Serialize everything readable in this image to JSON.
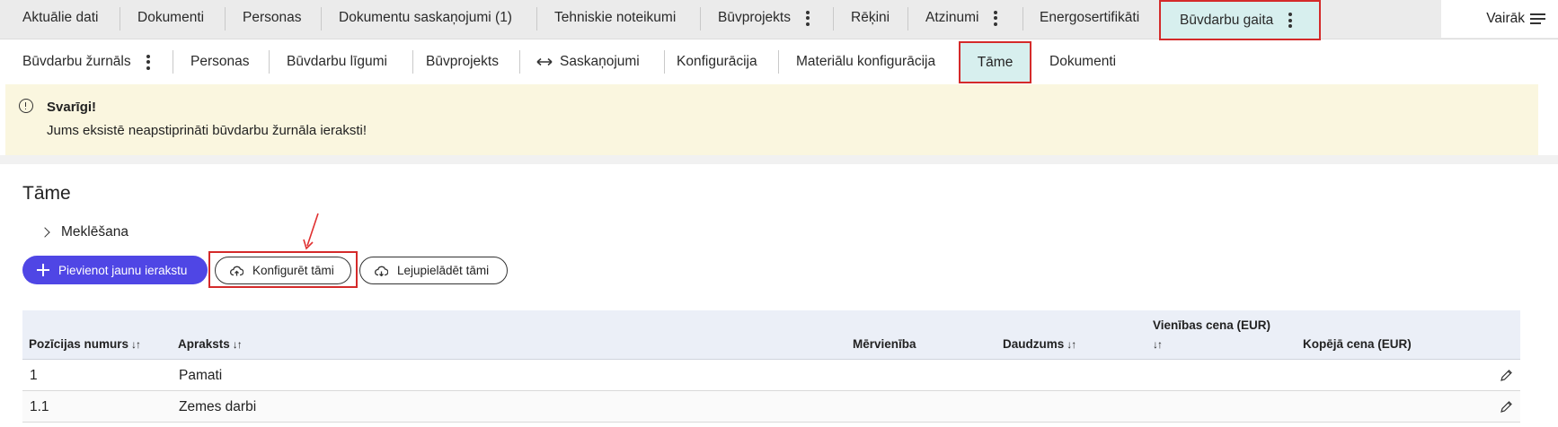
{
  "top_nav": {
    "tabs": [
      {
        "label": "Aktuālie dati"
      },
      {
        "label": "Dokumenti"
      },
      {
        "label": "Personas"
      },
      {
        "label": "Dokumentu saskaņojumi (1)"
      },
      {
        "label": "Tehniskie noteikumi"
      },
      {
        "label": "Būvprojekts"
      },
      {
        "label": "Rēķini"
      },
      {
        "label": "Atzinumi"
      },
      {
        "label": "Energosertifikāti"
      },
      {
        "label": "Būvdarbu gaita"
      }
    ],
    "active": "Būvdarbu gaita",
    "more_label": "Vairāk"
  },
  "sub_nav": {
    "tabs": [
      {
        "label": "Būvdarbu žurnāls"
      },
      {
        "label": "Personas"
      },
      {
        "label": "Būvdarbu līgumi"
      },
      {
        "label": "Būvprojekts"
      },
      {
        "label": "Saskaņojumi"
      },
      {
        "label": "Konfigurācija"
      },
      {
        "label": "Materiālu konfigurācija"
      },
      {
        "label": "Tāme"
      },
      {
        "label": "Dokumenti"
      }
    ],
    "active": "Tāme"
  },
  "alert": {
    "title": "Svarīgi!",
    "message": "Jums eksistē neapstiprināti būvdarbu žurnāla ieraksti!"
  },
  "main": {
    "title": "Tāme",
    "search_label": "Meklēšana",
    "buttons": {
      "add": "Pievienot jaunu ierakstu",
      "configure": "Konfigurēt tāmi",
      "download": "Lejupielādēt tāmi"
    }
  },
  "table": {
    "columns": [
      {
        "label": "Pozīcijas numurs",
        "sort": "↓↑"
      },
      {
        "label": "Apraksts",
        "sort": "↓↑"
      },
      {
        "label": "Mērvienība"
      },
      {
        "label": "Daudzums",
        "sort": "↓↑"
      },
      {
        "label": "Vienības cena (EUR)",
        "sort": "↓↑"
      },
      {
        "label": "Kopējā cena (EUR)"
      }
    ],
    "rows": [
      {
        "number": "1",
        "description": "Pamati"
      },
      {
        "number": "1.1",
        "description": "Zemes darbi"
      }
    ]
  },
  "colors": {
    "primary": "#4f46e5",
    "active_tab_bg": "#d7efee",
    "highlight": "#d42a2a",
    "alert_bg": "#faf6df"
  }
}
